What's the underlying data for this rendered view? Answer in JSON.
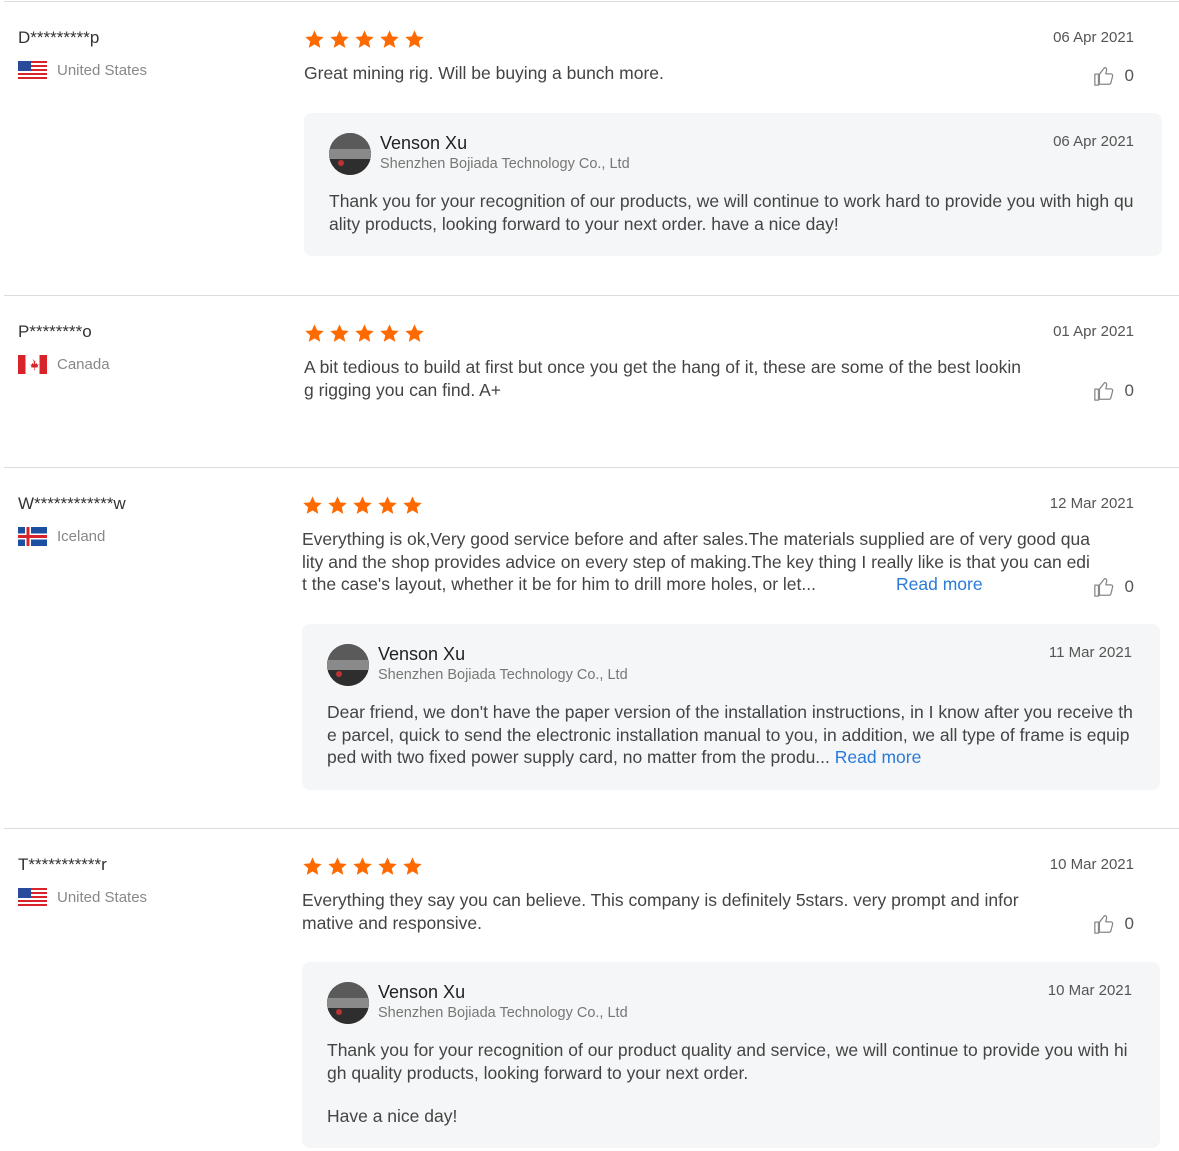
{
  "reviews": [
    {
      "name": "D*********p",
      "country": "United States",
      "rating": 5,
      "date": "06 Apr 2021",
      "text": "Great mining rig. Will be buying a bunch more.",
      "likes": "0",
      "reply": {
        "name": "Venson Xu",
        "company": "Shenzhen Bojiada Technology Co., Ltd",
        "date": "06 Apr 2021",
        "text": "Thank you for your recognition of our products, we will continue to work hard to provide you with high quality products, looking forward to your next order. have a nice day!"
      }
    },
    {
      "name": "P********o",
      "country": "Canada",
      "rating": 5,
      "date": "01 Apr 2021",
      "text": "A bit tedious to build at first but once you get the hang of it, these are some of the best looking rigging you can find. A+",
      "likes": "0"
    },
    {
      "name": "W************w",
      "country": "Iceland",
      "rating": 5,
      "date": "12 Mar 2021",
      "text": "Everything is ok,Very good service before and after sales.The materials supplied are of very good quality and the shop provides advice on every step of making.The key thing I really like is that you can edit the case's layout, whether it be for him to drill more holes, or let...",
      "read_more": "Read more",
      "likes": "0",
      "reply": {
        "name": "Venson Xu",
        "company": "Shenzhen Bojiada Technology Co., Ltd",
        "date": "11 Mar 2021",
        "text": "Dear friend, we don't have the paper version of the installation instructions, in I know after you receive the parcel, quick to send the electronic installation manual to you, in addition, we all type of frame is equipped with two fixed power supply card, no matter from the produ... ",
        "read_more": "Read more"
      }
    },
    {
      "name": "T***********r",
      "country": "United States",
      "rating": 5,
      "date": "10 Mar 2021",
      "text": "Everything they say you can believe. This company is definitely 5stars. very prompt and informative and responsive.",
      "likes": "0",
      "reply": {
        "name": "Venson Xu",
        "company": "Shenzhen Bojiada Technology Co., Ltd",
        "date": "10 Mar 2021",
        "text": "Thank you for your recognition of our product quality and service, we will continue to provide you with high quality products, looking forward to your next order.",
        "extra": "Have a  nice day!"
      }
    }
  ],
  "icons": {
    "star": "star-icon",
    "like": "thumbs-up-icon",
    "flags": [
      "us-flag-icon",
      "canada-flag-icon",
      "iceland-flag-icon"
    ],
    "avatar": "seller-avatar"
  },
  "colors": {
    "star": "#ff6a00",
    "link": "#2a7ad8",
    "reply_background": "#f5f6f7"
  }
}
